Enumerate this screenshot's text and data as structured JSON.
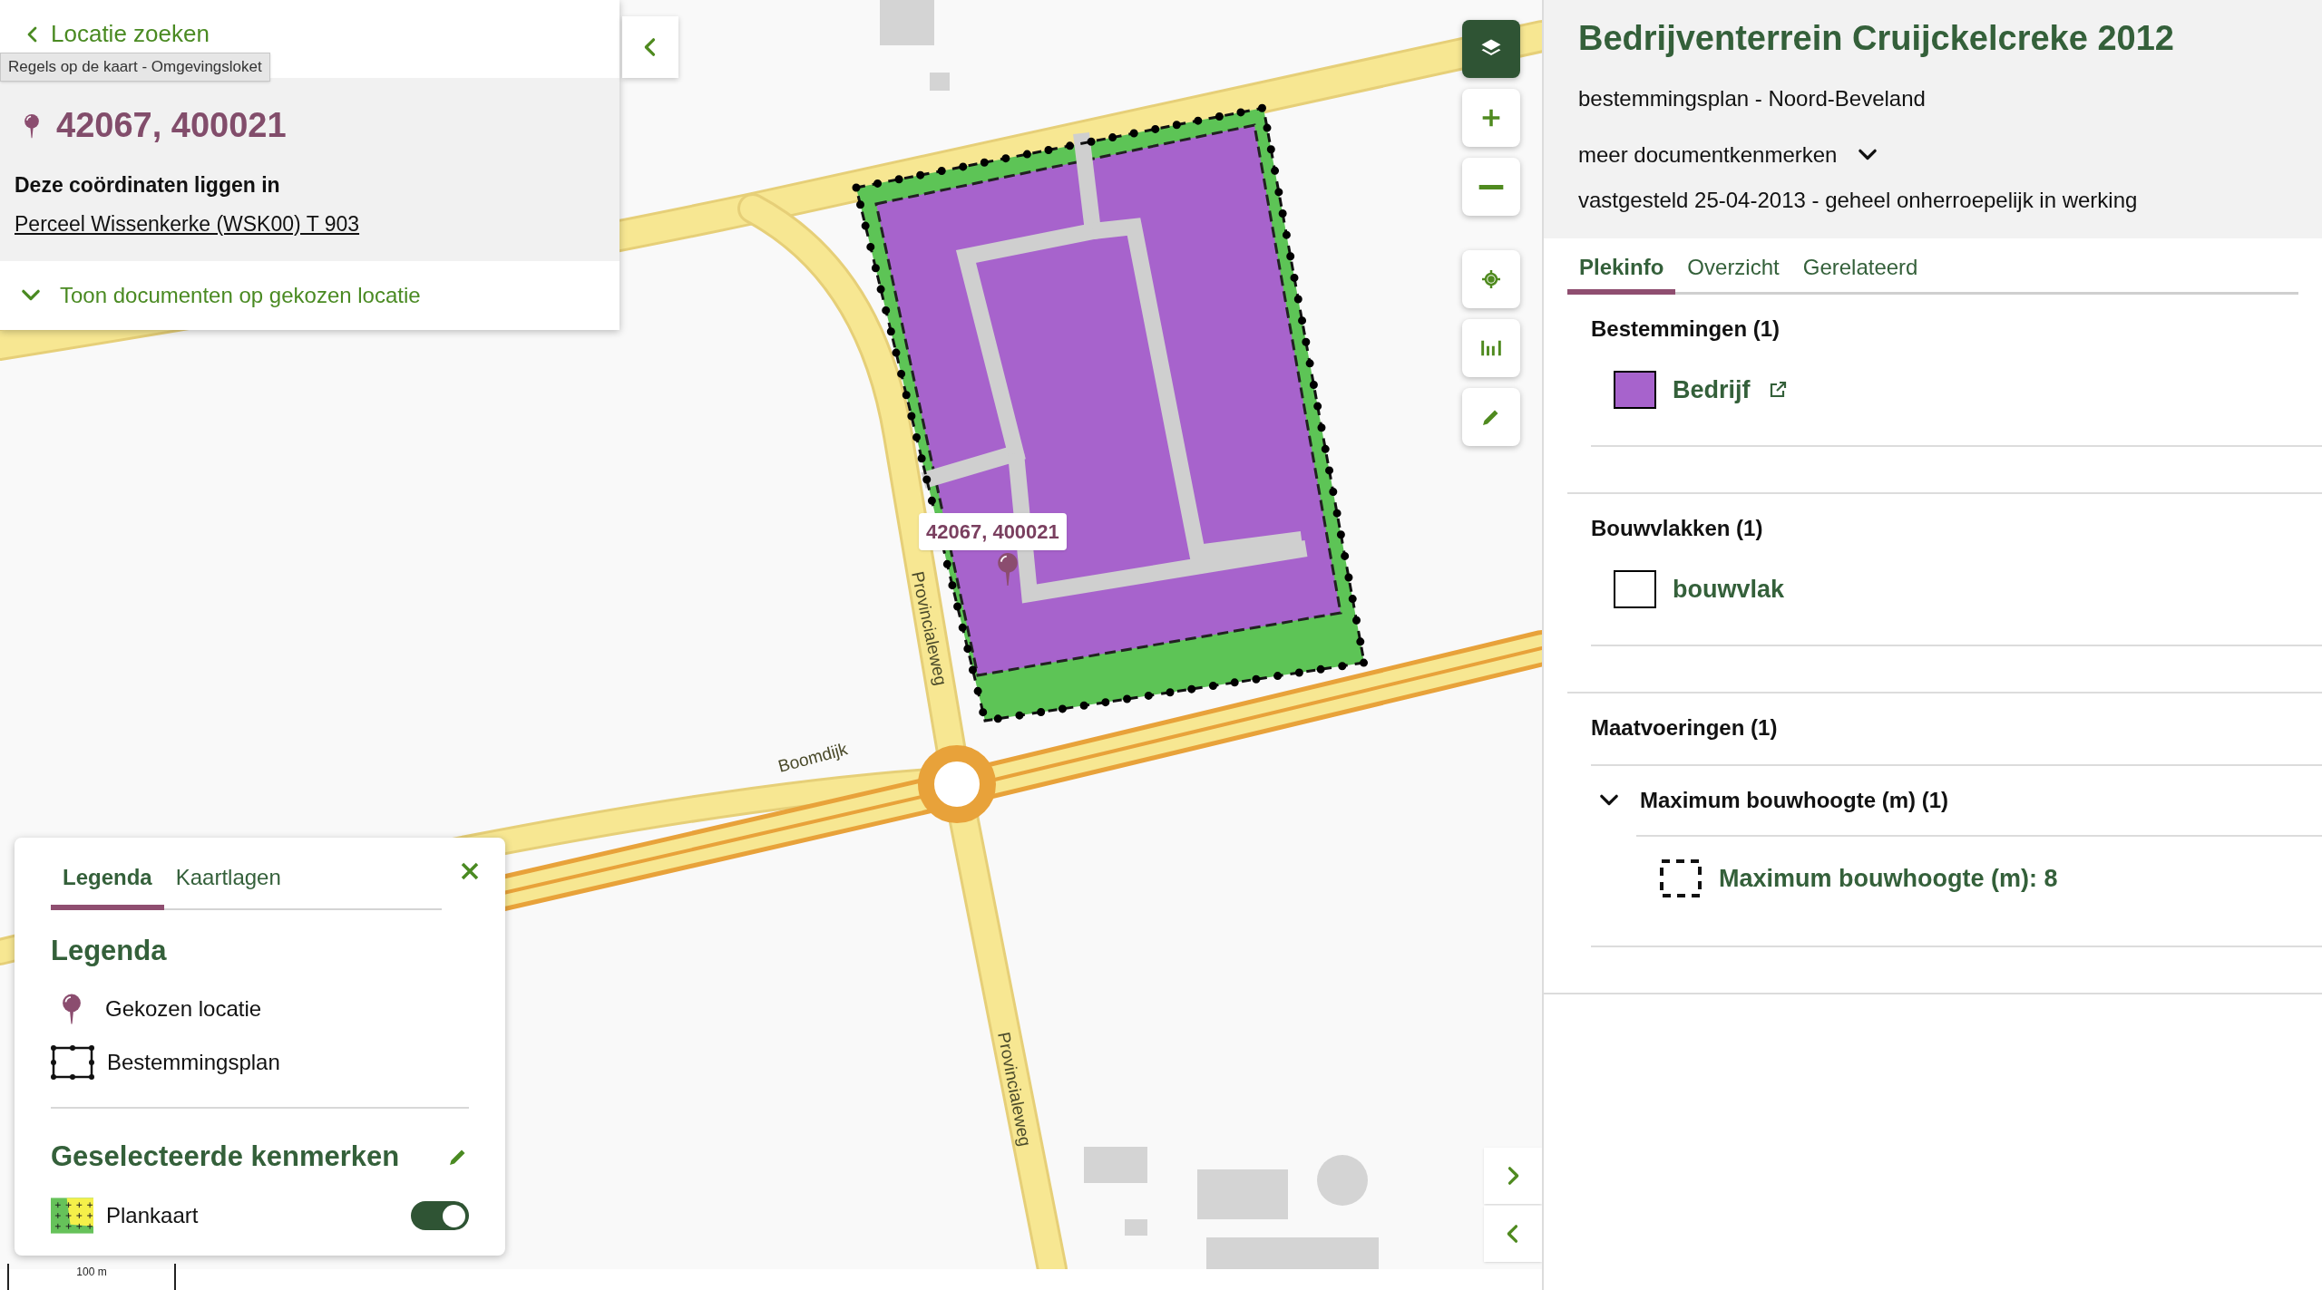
{
  "back_link": "Locatie zoeken",
  "tooltip": "Regels op de kaart - Omgevingsloket",
  "location": {
    "coordinates": "42067, 400021",
    "intro": "Deze coördinaten liggen in",
    "parcel": "Perceel Wissenkerke (WSK00) T 903",
    "toggle": "Toon documenten op gekozen locatie",
    "expanded": false
  },
  "map": {
    "marker_label": "42067, 400021",
    "road_labels": [
      "Provincialeweg",
      "Boomdijk",
      "Provincialeweg"
    ],
    "scale": "100 m"
  },
  "legend_panel": {
    "tabs": [
      {
        "label": "Legenda",
        "selected": true
      },
      {
        "label": "Kaartlagen",
        "selected": false
      }
    ],
    "heading": "Legenda",
    "items": [
      {
        "kind": "pin",
        "label": "Gekozen locatie"
      },
      {
        "kind": "outline",
        "label": "Bestemmingsplan"
      }
    ],
    "selected_heading": "Geselecteerde kenmerken",
    "layers": [
      {
        "label": "Plankaart",
        "on": true
      }
    ]
  },
  "document": {
    "title": "Bedrijventerrein Cruijckelcreke 2012",
    "subtitle": "bestemmingsplan - Noord-Beveland",
    "more": "meer documentkenmerken",
    "status": "vastgesteld 25-04-2013 - geheel onherroepelijk in werking",
    "tabs": [
      {
        "label": "Plekinfo",
        "selected": true
      },
      {
        "label": "Overzicht",
        "selected": false
      },
      {
        "label": "Gerelateerd",
        "selected": false
      }
    ],
    "sections": [
      {
        "heading": "Bestemmingen (1)",
        "items": [
          {
            "kind": "fill",
            "label": "Bedrijf",
            "external": true
          }
        ]
      },
      {
        "heading": "Bouwvlakken (1)",
        "items": [
          {
            "kind": "outline",
            "label": "bouwvlak",
            "external": false
          }
        ]
      },
      {
        "heading": "Maatvoeringen (1)",
        "groups": [
          {
            "label": "Maximum bouwhoogte (m) (1)",
            "expanded": true,
            "children": [
              {
                "kind": "dashed",
                "label": "Maximum bouwhoogte (m): 8",
                "external": false
              }
            ]
          }
        ]
      }
    ]
  }
}
